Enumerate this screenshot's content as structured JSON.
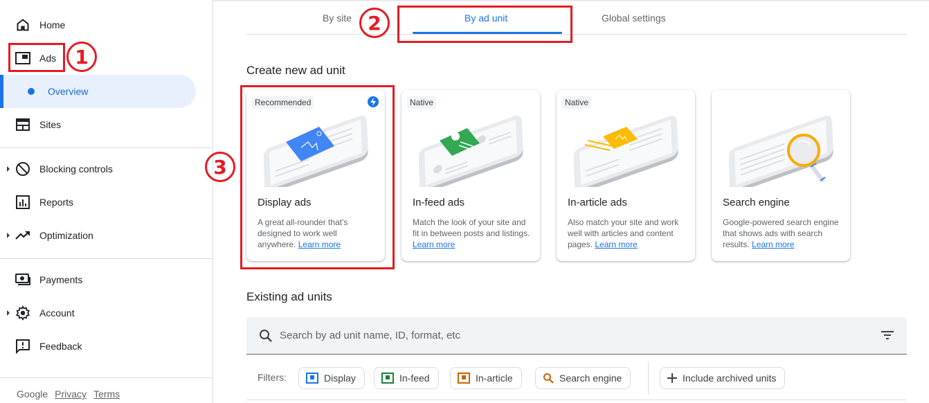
{
  "sidebar": {
    "items": [
      {
        "label": "Home",
        "icon": "home-icon"
      },
      {
        "label": "Ads",
        "icon": "ads-icon"
      },
      {
        "label": "Overview",
        "icon": "dot-icon",
        "active": true
      },
      {
        "label": "Sites",
        "icon": "sites-icon"
      },
      {
        "label": "Blocking controls",
        "icon": "block-icon",
        "expandable": true
      },
      {
        "label": "Reports",
        "icon": "reports-icon"
      },
      {
        "label": "Optimization",
        "icon": "trending-up-icon",
        "expandable": true
      },
      {
        "label": "Payments",
        "icon": "payments-icon"
      },
      {
        "label": "Account",
        "icon": "gear-icon",
        "expandable": true
      },
      {
        "label": "Feedback",
        "icon": "feedback-icon"
      }
    ],
    "footer": {
      "brand": "Google",
      "privacy": "Privacy",
      "terms": "Terms"
    }
  },
  "tabs": [
    {
      "label": "By site"
    },
    {
      "label": "By ad unit",
      "active": true
    },
    {
      "label": "Global settings"
    }
  ],
  "create": {
    "title": "Create new ad unit",
    "cards": [
      {
        "badge": "Recommended",
        "title": "Display ads",
        "desc": "A great all-rounder that's designed to work well anywhere.",
        "link": "Learn more",
        "accent": "#4285f4"
      },
      {
        "badge": "Native",
        "title": "In-feed ads",
        "desc": "Match the look of your site and fit in between posts and listings.",
        "link": "Learn more",
        "accent": "#34a853"
      },
      {
        "badge": "Native",
        "title": "In-article ads",
        "desc": "Also match your site and work well with articles and content pages.",
        "link": "Learn more",
        "accent": "#fbbc04"
      },
      {
        "badge": "",
        "title": "Search engine",
        "desc": "Google-powered search engine that shows ads with search results.",
        "link": "Learn more",
        "accent": "#f9ab00"
      }
    ]
  },
  "existing": {
    "title": "Existing ad units",
    "search_placeholder": "Search by ad unit name, ID, format, etc",
    "filters_label": "Filters:",
    "chips": [
      {
        "label": "Display",
        "color": "#1a73e8"
      },
      {
        "label": "In-feed",
        "color": "#188038"
      },
      {
        "label": "In-article",
        "color": "#c26401"
      },
      {
        "label": "Search engine",
        "color": "#c26401"
      }
    ],
    "archived_label": "Include archived units"
  },
  "annotations": [
    "1",
    "2",
    "3"
  ],
  "colors": {
    "accent": "#1a73e8",
    "annotation": "#e51b23"
  }
}
